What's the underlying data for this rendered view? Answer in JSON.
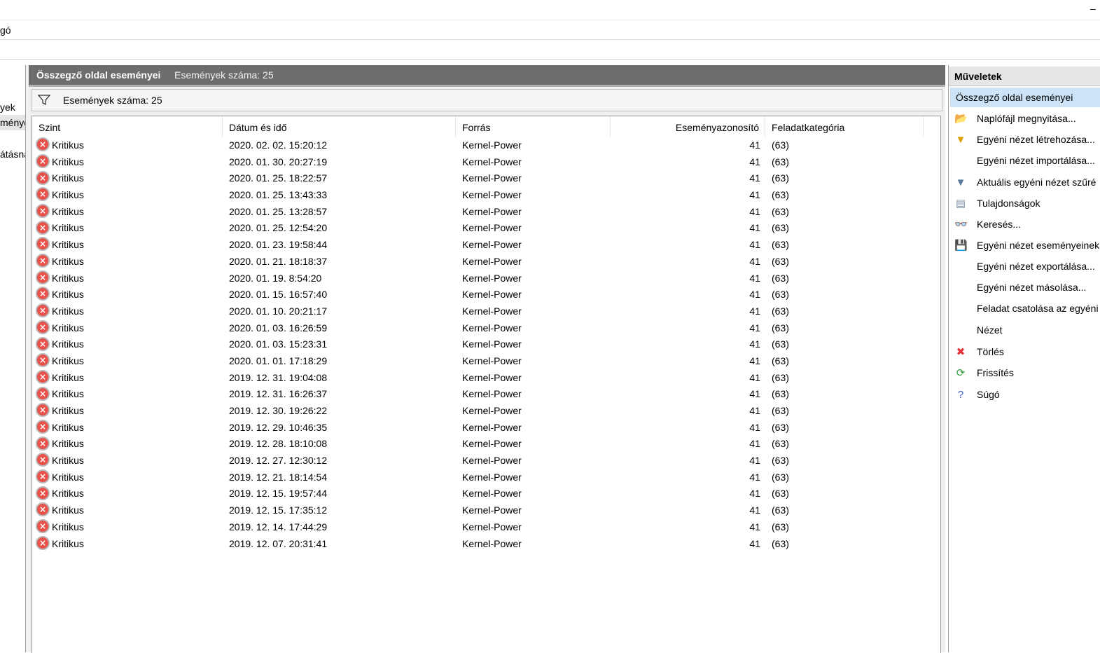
{
  "window": {
    "minimize_glyph": "–"
  },
  "menu": {
    "visible_item": "gó"
  },
  "tree": {
    "items": [
      {
        "label": "yek",
        "selected": false
      },
      {
        "label": "ménye",
        "selected": true
      },
      {
        "label": "",
        "selected": false
      },
      {
        "label": "átásna",
        "selected": false
      }
    ]
  },
  "center": {
    "title": "Összegző oldal eseményei",
    "count_label": "Események száma: 25",
    "infobar_text": "Események száma: 25",
    "columns": [
      "Szint",
      "Dátum és idő",
      "Forrás",
      "Eseményazonosító",
      "Feladatkategória"
    ],
    "rows": [
      {
        "level": "Kritikus",
        "date": "2020. 02. 02. 15:20:12",
        "source": "Kernel-Power",
        "id": "41",
        "category": "(63)"
      },
      {
        "level": "Kritikus",
        "date": "2020. 01. 30. 20:27:19",
        "source": "Kernel-Power",
        "id": "41",
        "category": "(63)"
      },
      {
        "level": "Kritikus",
        "date": "2020. 01. 25. 18:22:57",
        "source": "Kernel-Power",
        "id": "41",
        "category": "(63)"
      },
      {
        "level": "Kritikus",
        "date": "2020. 01. 25. 13:43:33",
        "source": "Kernel-Power",
        "id": "41",
        "category": "(63)"
      },
      {
        "level": "Kritikus",
        "date": "2020. 01. 25. 13:28:57",
        "source": "Kernel-Power",
        "id": "41",
        "category": "(63)"
      },
      {
        "level": "Kritikus",
        "date": "2020. 01. 25. 12:54:20",
        "source": "Kernel-Power",
        "id": "41",
        "category": "(63)"
      },
      {
        "level": "Kritikus",
        "date": "2020. 01. 23. 19:58:44",
        "source": "Kernel-Power",
        "id": "41",
        "category": "(63)"
      },
      {
        "level": "Kritikus",
        "date": "2020. 01. 21. 18:18:37",
        "source": "Kernel-Power",
        "id": "41",
        "category": "(63)"
      },
      {
        "level": "Kritikus",
        "date": "2020. 01. 19. 8:54:20",
        "source": "Kernel-Power",
        "id": "41",
        "category": "(63)"
      },
      {
        "level": "Kritikus",
        "date": "2020. 01. 15. 16:57:40",
        "source": "Kernel-Power",
        "id": "41",
        "category": "(63)"
      },
      {
        "level": "Kritikus",
        "date": "2020. 01. 10. 20:21:17",
        "source": "Kernel-Power",
        "id": "41",
        "category": "(63)"
      },
      {
        "level": "Kritikus",
        "date": "2020. 01. 03. 16:26:59",
        "source": "Kernel-Power",
        "id": "41",
        "category": "(63)"
      },
      {
        "level": "Kritikus",
        "date": "2020. 01. 03. 15:23:31",
        "source": "Kernel-Power",
        "id": "41",
        "category": "(63)"
      },
      {
        "level": "Kritikus",
        "date": "2020. 01. 01. 17:18:29",
        "source": "Kernel-Power",
        "id": "41",
        "category": "(63)"
      },
      {
        "level": "Kritikus",
        "date": "2019. 12. 31. 19:04:08",
        "source": "Kernel-Power",
        "id": "41",
        "category": "(63)"
      },
      {
        "level": "Kritikus",
        "date": "2019. 12. 31. 16:26:37",
        "source": "Kernel-Power",
        "id": "41",
        "category": "(63)"
      },
      {
        "level": "Kritikus",
        "date": "2019. 12. 30. 19:26:22",
        "source": "Kernel-Power",
        "id": "41",
        "category": "(63)"
      },
      {
        "level": "Kritikus",
        "date": "2019. 12. 29. 10:46:35",
        "source": "Kernel-Power",
        "id": "41",
        "category": "(63)"
      },
      {
        "level": "Kritikus",
        "date": "2019. 12. 28. 18:10:08",
        "source": "Kernel-Power",
        "id": "41",
        "category": "(63)"
      },
      {
        "level": "Kritikus",
        "date": "2019. 12. 27. 12:30:12",
        "source": "Kernel-Power",
        "id": "41",
        "category": "(63)"
      },
      {
        "level": "Kritikus",
        "date": "2019. 12. 21. 18:14:54",
        "source": "Kernel-Power",
        "id": "41",
        "category": "(63)"
      },
      {
        "level": "Kritikus",
        "date": "2019. 12. 15. 19:57:44",
        "source": "Kernel-Power",
        "id": "41",
        "category": "(63)"
      },
      {
        "level": "Kritikus",
        "date": "2019. 12. 15. 17:35:12",
        "source": "Kernel-Power",
        "id": "41",
        "category": "(63)"
      },
      {
        "level": "Kritikus",
        "date": "2019. 12. 14. 17:44:29",
        "source": "Kernel-Power",
        "id": "41",
        "category": "(63)"
      },
      {
        "level": "Kritikus",
        "date": "2019. 12. 07. 20:31:41",
        "source": "Kernel-Power",
        "id": "41",
        "category": "(63)"
      }
    ]
  },
  "actions": {
    "header": "Műveletek",
    "section": "Összegző oldal eseményei",
    "items": [
      {
        "label": "Naplófájl megnyitása...",
        "icon": "folder-open-icon",
        "glyph": "📂",
        "color": "#e0a000"
      },
      {
        "label": "Egyéni nézet létrehozása...",
        "icon": "filter-create-icon",
        "glyph": "▼",
        "color": "#d8a000"
      },
      {
        "label": "Egyéni nézet importálása...",
        "icon": "",
        "glyph": "",
        "color": ""
      },
      {
        "label": "Aktuális egyéni nézet szűré",
        "icon": "filter-icon",
        "glyph": "▼",
        "color": "#5a7aa0"
      },
      {
        "label": "Tulajdonságok",
        "icon": "properties-icon",
        "glyph": "▤",
        "color": "#7a8ea8"
      },
      {
        "label": "Keresés...",
        "icon": "binoculars-icon",
        "glyph": "👓",
        "color": "#555555"
      },
      {
        "label": "Egyéni nézet eseményeinek",
        "icon": "save-icon",
        "glyph": "💾",
        "color": "#333333"
      },
      {
        "label": "Egyéni nézet exportálása...",
        "icon": "",
        "glyph": "",
        "color": ""
      },
      {
        "label": "Egyéni nézet másolása...",
        "icon": "",
        "glyph": "",
        "color": ""
      },
      {
        "label": "Feladat csatolása az egyéni",
        "icon": "",
        "glyph": "",
        "color": ""
      },
      {
        "label": "Nézet",
        "icon": "",
        "glyph": "",
        "color": ""
      },
      {
        "label": "Törlés",
        "icon": "delete-icon",
        "glyph": "✖",
        "color": "#e03030"
      },
      {
        "label": "Frissítés",
        "icon": "refresh-icon",
        "glyph": "⟳",
        "color": "#2f9a3a"
      },
      {
        "label": "Súgó",
        "icon": "help-icon",
        "glyph": "?",
        "color": "#3a5fc8"
      }
    ]
  },
  "colors": {
    "header_bg": "#6d6d6d",
    "selection": "#cde4f7",
    "critical": "#e8524a"
  }
}
